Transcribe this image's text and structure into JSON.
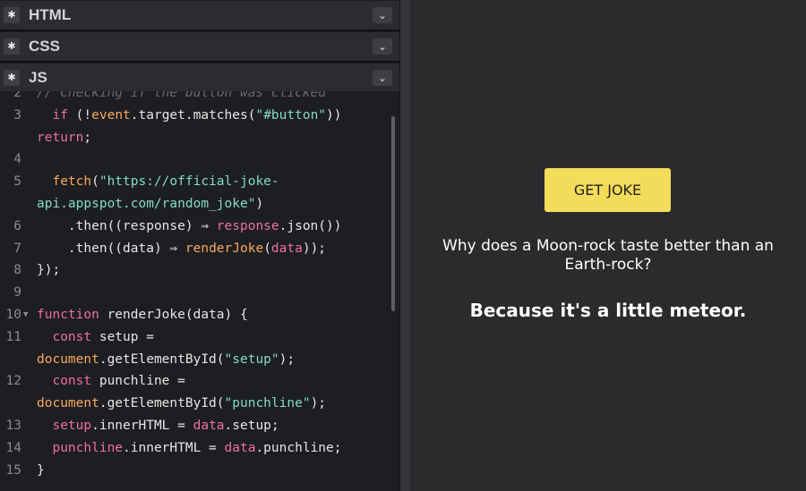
{
  "panels": {
    "html": {
      "title": "HTML",
      "settings_icon": "gear-icon",
      "toggle_icon": "chevron-down-icon"
    },
    "css": {
      "title": "CSS",
      "settings_icon": "gear-icon",
      "toggle_icon": "chevron-down-icon"
    },
    "js": {
      "title": "JS",
      "settings_icon": "gear-icon",
      "toggle_icon": "chevron-down-icon"
    }
  },
  "code": {
    "line_numbers": [
      "2",
      "3",
      "",
      "4",
      "5",
      "",
      "6",
      "7",
      "8",
      "9",
      "10",
      "11",
      "",
      "12",
      "",
      "13",
      "14",
      "15"
    ],
    "lines": [
      [
        {
          "t": "// Checking if the button was clicked",
          "c": "cm"
        }
      ],
      [
        {
          "t": "  if ",
          "c": "kw"
        },
        {
          "t": "(!",
          "c": "pl"
        },
        {
          "t": "event",
          "c": "fn"
        },
        {
          "t": ".target.matches(",
          "c": "pl"
        },
        {
          "t": "\"#button\"",
          "c": "str"
        },
        {
          "t": "))",
          "c": "pl"
        }
      ],
      [
        {
          "t": "return",
          "c": "kw"
        },
        {
          "t": ";",
          "c": "pl"
        }
      ],
      [],
      [
        {
          "t": "  fetch",
          "c": "fn"
        },
        {
          "t": "(",
          "c": "pl"
        },
        {
          "t": "\"https://official-joke-",
          "c": "str"
        }
      ],
      [
        {
          "t": "api.appspot.com/random_joke\"",
          "c": "str"
        },
        {
          "t": ")",
          "c": "pl"
        }
      ],
      [
        {
          "t": "    .then((response) ⇒ ",
          "c": "pl"
        },
        {
          "t": "response",
          "c": "kw"
        },
        {
          "t": ".json())",
          "c": "pl"
        }
      ],
      [
        {
          "t": "    .then((data) ⇒ ",
          "c": "pl"
        },
        {
          "t": "renderJoke",
          "c": "fn"
        },
        {
          "t": "(",
          "c": "pl"
        },
        {
          "t": "data",
          "c": "kw"
        },
        {
          "t": "));",
          "c": "pl"
        }
      ],
      [
        {
          "t": "});",
          "c": "pl"
        }
      ],
      [],
      [
        {
          "t": "function ",
          "c": "kw"
        },
        {
          "t": "renderJoke(data) {",
          "c": "pl"
        }
      ],
      [
        {
          "t": "  const ",
          "c": "kw"
        },
        {
          "t": "setup =",
          "c": "pl"
        }
      ],
      [
        {
          "t": "document",
          "c": "fn"
        },
        {
          "t": ".getElementById(",
          "c": "pl"
        },
        {
          "t": "\"setup\"",
          "c": "str"
        },
        {
          "t": ");",
          "c": "pl"
        }
      ],
      [
        {
          "t": "  const ",
          "c": "kw"
        },
        {
          "t": "punchline =",
          "c": "pl"
        }
      ],
      [
        {
          "t": "document",
          "c": "fn"
        },
        {
          "t": ".getElementById(",
          "c": "pl"
        },
        {
          "t": "\"punchline\"",
          "c": "str"
        },
        {
          "t": ");",
          "c": "pl"
        }
      ],
      [
        {
          "t": "  setup",
          "c": "kw"
        },
        {
          "t": ".innerHTML = ",
          "c": "pl"
        },
        {
          "t": "data",
          "c": "kw"
        },
        {
          "t": ".setup;",
          "c": "pl"
        }
      ],
      [
        {
          "t": "  punchline",
          "c": "kw"
        },
        {
          "t": ".innerHTML = ",
          "c": "pl"
        },
        {
          "t": "data",
          "c": "kw"
        },
        {
          "t": ".punchline;",
          "c": "pl"
        }
      ],
      [
        {
          "t": "}",
          "c": "pl"
        }
      ]
    ],
    "fold_line": "10",
    "colors": {
      "keyword": "#ee6ea6",
      "string": "#84dcc0",
      "function": "#f9a95b",
      "comment": "#6a6b72",
      "plain": "#e6e6e6"
    }
  },
  "preview": {
    "button_label": "GET JOKE",
    "button_color": "#f4dc5b",
    "setup": "Why does a Moon-rock taste better than an Earth-rock?",
    "punchline": "Because it's a little meteor."
  }
}
